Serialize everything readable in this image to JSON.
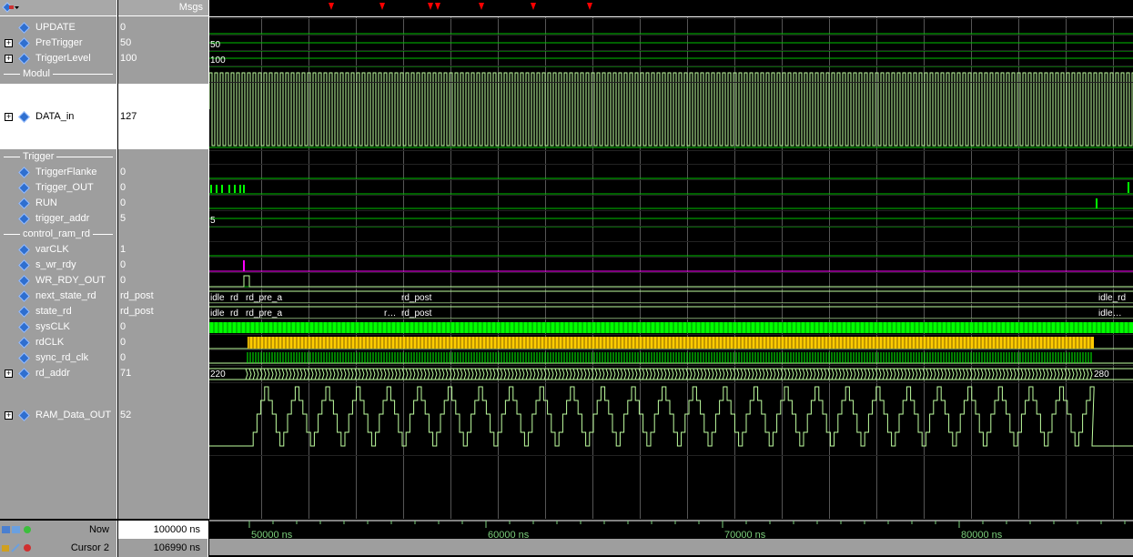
{
  "header": {
    "msgs_label": "Msgs"
  },
  "signals": [
    {
      "name": "UPDATE",
      "value": "0"
    },
    {
      "name": "PreTrigger",
      "value": "50"
    },
    {
      "name": "TriggerLevel",
      "value": "100"
    },
    {
      "name": "Modul",
      "value": ""
    },
    {
      "name": "DATA_in",
      "value": "127"
    },
    {
      "name": "Trigger",
      "value": ""
    },
    {
      "name": "TriggerFlanke",
      "value": "0"
    },
    {
      "name": "Trigger_OUT",
      "value": "0"
    },
    {
      "name": "RUN",
      "value": "0"
    },
    {
      "name": "trigger_addr",
      "value": "5"
    },
    {
      "name": "control_ram_rd",
      "value": ""
    },
    {
      "name": "varCLK",
      "value": "1"
    },
    {
      "name": "s_wr_rdy",
      "value": "0"
    },
    {
      "name": "WR_RDY_OUT",
      "value": "0"
    },
    {
      "name": "next_state_rd",
      "value": "rd_post"
    },
    {
      "name": "state_rd",
      "value": "rd_post"
    },
    {
      "name": "sysCLK",
      "value": "0"
    },
    {
      "name": "rdCLK",
      "value": "0"
    },
    {
      "name": "sync_rd_clk",
      "value": "0"
    },
    {
      "name": "rd_addr",
      "value": "71"
    },
    {
      "name": "RAM_Data_OUT",
      "value": "52"
    }
  ],
  "wave_labels": {
    "pretrigger": "50",
    "triggerlevel": "100",
    "trigger_addr": "5",
    "next_state_1": "idle",
    "next_state_2": "rd",
    "next_state_3": "rd_pre_a",
    "next_state_4": "rd_post",
    "next_state_5": "idle_rd",
    "state_1": "idle",
    "state_2": "rd",
    "state_3": "rd_pre_a",
    "state_4": "r…",
    "state_5": "rd_post",
    "state_6": "idle…",
    "rd_addr_start": "220",
    "rd_addr_end": "280"
  },
  "status": {
    "now_label": "Now",
    "now_value": "100000 ns",
    "cursor_label": "Cursor 2",
    "cursor_value": "106990 ns"
  },
  "timeline": {
    "ticks": [
      "50000 ns",
      "60000 ns",
      "70000 ns",
      "80000 ns"
    ]
  },
  "colors": {
    "panel": "#9e9e9e",
    "wave_green": "#bfffa0",
    "bright_green": "#00ff00",
    "magenta": "#ff00ff",
    "yellow": "#ffcc00",
    "marker_red": "#ff0000"
  }
}
